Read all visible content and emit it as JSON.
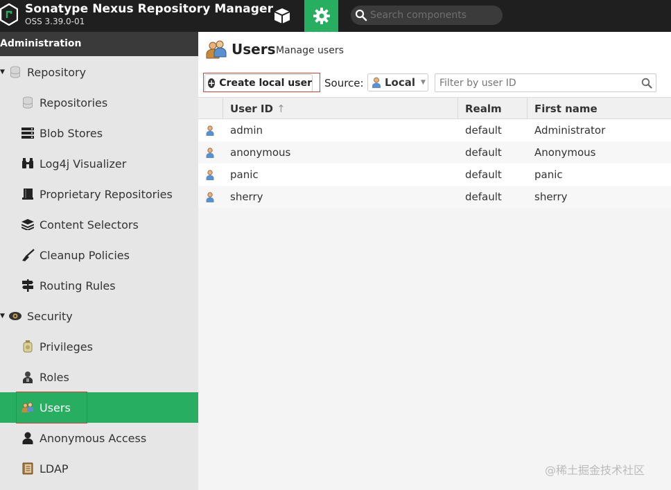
{
  "header": {
    "app_title": "Sonatype Nexus Repository Manager",
    "app_version": "OSS 3.39.0-01",
    "search_placeholder": "Search components",
    "accent_color": "#27ae60"
  },
  "sidebar": {
    "header": "Administration",
    "items": [
      {
        "label": "Repository",
        "icon": "database-icon",
        "group": true
      },
      {
        "label": "Repositories",
        "icon": "database-icon"
      },
      {
        "label": "Blob Stores",
        "icon": "server-icon"
      },
      {
        "label": "Log4j Visualizer",
        "icon": "binoculars-icon"
      },
      {
        "label": "Proprietary Repositories",
        "icon": "book-icon"
      },
      {
        "label": "Content Selectors",
        "icon": "layers-icon"
      },
      {
        "label": "Cleanup Policies",
        "icon": "broom-icon"
      },
      {
        "label": "Routing Rules",
        "icon": "signpost-icon"
      },
      {
        "label": "Security",
        "icon": "eye-icon",
        "group": true
      },
      {
        "label": "Privileges",
        "icon": "badge-icon"
      },
      {
        "label": "Roles",
        "icon": "role-user-icon"
      },
      {
        "label": "Users",
        "icon": "users-icon",
        "selected": true
      },
      {
        "label": "Anonymous Access",
        "icon": "user-icon"
      },
      {
        "label": "LDAP",
        "icon": "ldap-book-icon"
      }
    ]
  },
  "main": {
    "title": "Users",
    "subtitle": "Manage users",
    "create_button": "Create local user",
    "source_label": "Source:",
    "source_value": "Local",
    "filter_placeholder": "Filter by user ID",
    "columns": [
      "User ID",
      "Realm",
      "First name"
    ],
    "sort_indicator": "↑",
    "rows": [
      {
        "user_id": "admin",
        "realm": "default",
        "first_name": "Administrator"
      },
      {
        "user_id": "anonymous",
        "realm": "default",
        "first_name": "Anonymous"
      },
      {
        "user_id": "panic",
        "realm": "default",
        "first_name": "panic"
      },
      {
        "user_id": "sherry",
        "realm": "default",
        "first_name": "sherry"
      }
    ]
  },
  "watermark": "@稀土掘金技术社区"
}
